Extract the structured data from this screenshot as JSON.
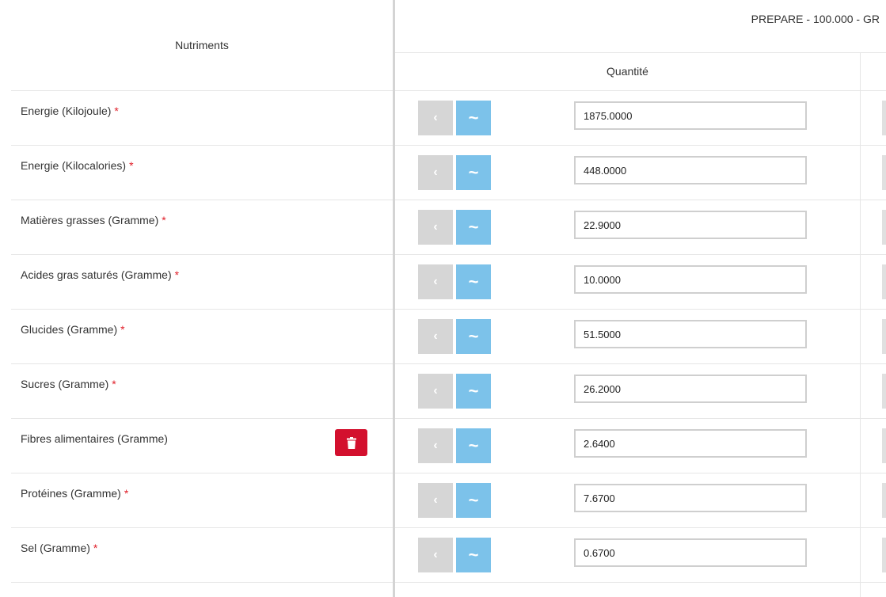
{
  "header": {
    "nutrients_label": "Nutriments",
    "prepare_label": "PREPARE - 100.000 - GR",
    "quantity_label": "Quantité"
  },
  "colors": {
    "required": "#e0202a",
    "delete_button": "#d3102e",
    "approx_button": "#7cc2ea",
    "prev_button": "#d6d6d6"
  },
  "icons": {
    "prev": "chevron-left-icon",
    "approx": "approximate-tilde-icon",
    "delete": "trash-icon"
  },
  "rows": [
    {
      "label": "Energie (Kilojoule)",
      "required": "*",
      "quantity": "1875.0000",
      "deletable": false
    },
    {
      "label": "Energie (Kilocalories)",
      "required": "*",
      "quantity": "448.0000",
      "deletable": false
    },
    {
      "label": "Matières grasses (Gramme)",
      "required": "*",
      "quantity": "22.9000",
      "deletable": false
    },
    {
      "label": "Acides gras saturés (Gramme)",
      "required": "*",
      "quantity": "10.0000",
      "deletable": false
    },
    {
      "label": "Glucides (Gramme)",
      "required": "*",
      "quantity": "51.5000",
      "deletable": false
    },
    {
      "label": "Sucres (Gramme)",
      "required": "*",
      "quantity": "26.2000",
      "deletable": false
    },
    {
      "label": "Fibres alimentaires (Gramme)",
      "required": "",
      "quantity": "2.6400",
      "deletable": true
    },
    {
      "label": "Protéines (Gramme)",
      "required": "*",
      "quantity": "7.6700",
      "deletable": false
    },
    {
      "label": "Sel (Gramme)",
      "required": "*",
      "quantity": "0.6700",
      "deletable": false
    }
  ],
  "buttons": {
    "prev_glyph": "‹",
    "approx_glyph": "~"
  }
}
